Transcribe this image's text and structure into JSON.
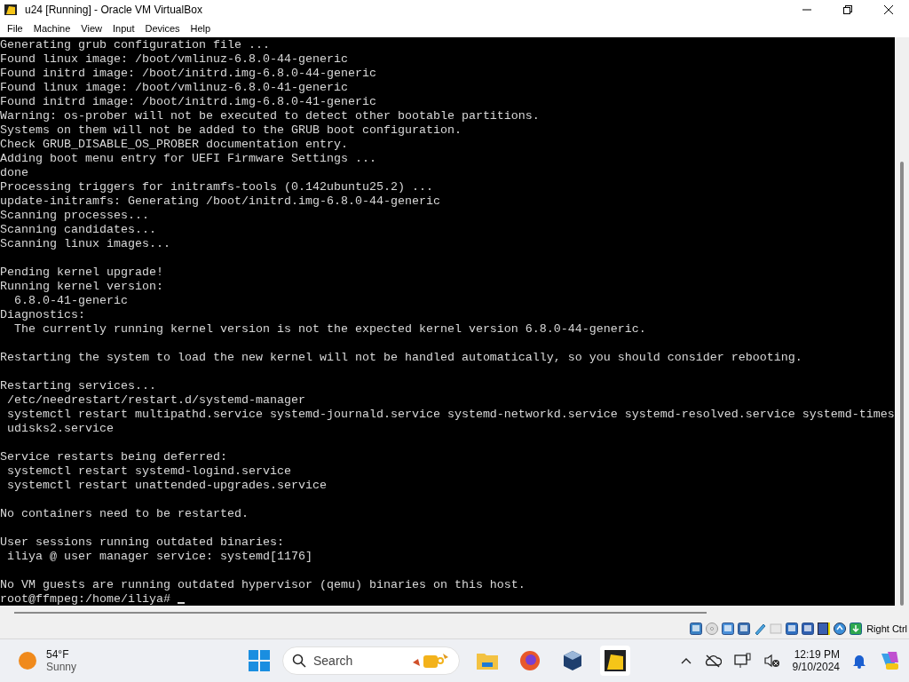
{
  "window": {
    "title": "u24 [Running] - Oracle VM VirtualBox"
  },
  "menu": [
    "File",
    "Machine",
    "View",
    "Input",
    "Devices",
    "Help"
  ],
  "terminal": {
    "blocks": [
      [
        "Generating grub configuration file ...",
        "Found linux image: /boot/vmlinuz-6.8.0-44-generic",
        "Found initrd image: /boot/initrd.img-6.8.0-44-generic",
        "Found linux image: /boot/vmlinuz-6.8.0-41-generic",
        "Found initrd image: /boot/initrd.img-6.8.0-41-generic",
        "Warning: os-prober will not be executed to detect other bootable partitions.",
        "Systems on them will not be added to the GRUB boot configuration.",
        "Check GRUB_DISABLE_OS_PROBER documentation entry.",
        "Adding boot menu entry for UEFI Firmware Settings ...",
        "done",
        "Processing triggers for initramfs-tools (0.142ubuntu25.2) ...",
        "update-initramfs: Generating /boot/initrd.img-6.8.0-44-generic",
        "Scanning processes...",
        "Scanning candidates...",
        "Scanning linux images..."
      ],
      [
        "Pending kernel upgrade!",
        "Running kernel version:",
        "  6.8.0-41-generic",
        "Diagnostics:",
        "  The currently running kernel version is not the expected kernel version 6.8.0-44-generic."
      ],
      [
        "Restarting the system to load the new kernel will not be handled automatically, so you should consider rebooting."
      ],
      [
        "Restarting services...",
        " /etc/needrestart/restart.d/systemd-manager",
        " systemctl restart multipathd.service systemd-journald.service systemd-networkd.service systemd-resolved.service systemd-times",
        " udisks2.service"
      ],
      [
        "Service restarts being deferred:",
        " systemctl restart systemd-logind.service",
        " systemctl restart unattended-upgrades.service"
      ],
      [
        "No containers need to be restarted."
      ],
      [
        "User sessions running outdated binaries:",
        " iliya @ user manager service: systemd[1176]"
      ],
      [
        "No VM guests are running outdated hypervisor (qemu) binaries on this host."
      ]
    ],
    "prompt": "root@ffmpeg:/home/iliya#"
  },
  "status_bar": {
    "host_key": "Right Ctrl"
  },
  "taskbar": {
    "weather": {
      "temperature": "54°F",
      "condition": "Sunny"
    },
    "search": {
      "placeholder": "Search"
    },
    "time": "12:19 PM",
    "date": "9/10/2024"
  }
}
